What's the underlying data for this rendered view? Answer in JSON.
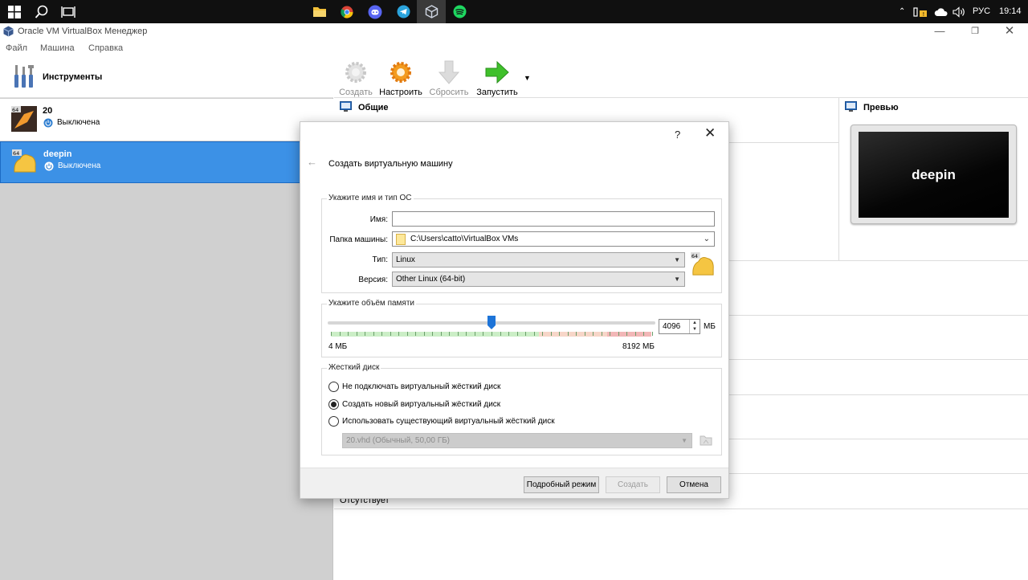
{
  "taskbar": {
    "tray": {
      "lang": "РУС",
      "time": "19:14"
    },
    "icons": [
      "windows-start-icon",
      "search-icon",
      "task-view-icon",
      "file-explorer-icon",
      "chrome-icon",
      "discord-icon",
      "telegram-icon",
      "virtualbox-icon",
      "spotify-icon"
    ]
  },
  "window": {
    "title": "Oracle VM VirtualBox Менеджер",
    "menu": [
      "Файл",
      "Машина",
      "Справка"
    ]
  },
  "sidebar": {
    "tools_label": "Инструменты",
    "vms": [
      {
        "name": "20",
        "status": "Выключена",
        "selected": false
      },
      {
        "name": "deepin",
        "status": "Выключена",
        "selected": true
      }
    ]
  },
  "toolbar": {
    "create": "Создать",
    "settings": "Настроить",
    "discard": "Сбросить",
    "start": "Запустить"
  },
  "details": {
    "general_header": "Общие",
    "preview_header": "Превью",
    "preview_vm_name": "deepin",
    "bottom_value": "Отсутствует"
  },
  "dialog": {
    "help": "?",
    "close": "✕",
    "back": "←",
    "title": "Создать виртуальную машину",
    "name_type_group": {
      "title": "Укажите имя и тип ОС",
      "name_label": "Имя:",
      "name_value": "",
      "folder_label": "Папка машины:",
      "folder_value": "C:\\Users\\catto\\VirtualBox VMs",
      "type_label": "Тип:",
      "type_value": "Linux",
      "version_label": "Версия:",
      "version_value": "Other Linux (64-bit)"
    },
    "memory_group": {
      "title": "Укажите объём памяти",
      "min_label": "4 МБ",
      "max_label": "8192 МБ",
      "value": "4096",
      "unit": "МБ",
      "value_fraction": 0.5
    },
    "disk_group": {
      "title": "Жесткий диск",
      "options": [
        {
          "label": "Не подключать виртуальный жёсткий диск",
          "checked": false
        },
        {
          "label": "Создать новый виртуальный жёсткий диск",
          "checked": true
        },
        {
          "label": "Использовать существующий виртуальный жёсткий диск",
          "checked": false
        }
      ],
      "existing_disk": "20.vhd (Обычный, 50,00 ГБ)"
    },
    "buttons": {
      "expert": "Подробный режим",
      "create": "Создать",
      "cancel": "Отмена"
    }
  }
}
